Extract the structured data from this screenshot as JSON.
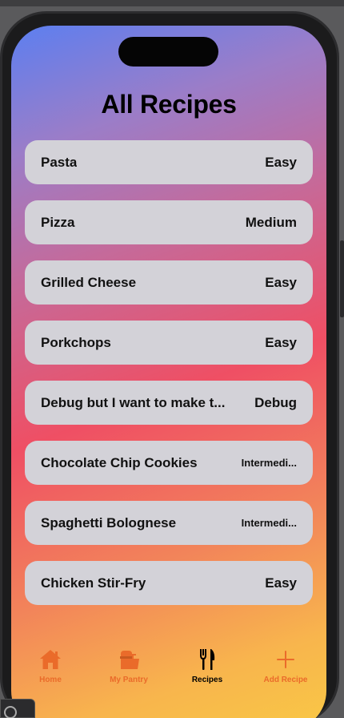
{
  "page": {
    "title": "All Recipes"
  },
  "recipes": [
    {
      "name": "Pasta",
      "difficulty": "Easy"
    },
    {
      "name": "Pizza",
      "difficulty": "Medium"
    },
    {
      "name": "Grilled Cheese",
      "difficulty": "Easy"
    },
    {
      "name": "Porkchops",
      "difficulty": "Easy"
    },
    {
      "name": "Debug but I want to make t...",
      "difficulty": "Debug"
    },
    {
      "name": "Chocolate Chip Cookies",
      "difficulty": "Intermedi..."
    },
    {
      "name": "Spaghetti Bolognese",
      "difficulty": "Intermedi..."
    },
    {
      "name": "Chicken Stir-Fry",
      "difficulty": "Easy"
    }
  ],
  "tabs": [
    {
      "label": "Home",
      "icon": "house-icon"
    },
    {
      "label": "My Pantry",
      "icon": "pantry-bag-icon"
    },
    {
      "label": "Recipes",
      "icon": "fork-knife-icon",
      "active": true
    },
    {
      "label": "Add Recipe",
      "icon": "plus-icon"
    }
  ],
  "colors": {
    "accent": "#ea6b2a",
    "row_background": "#d3d2d8",
    "gradient_top": "#5c7ff0",
    "gradient_mid": "#ef4f64",
    "gradient_bottom": "#f9c845"
  }
}
